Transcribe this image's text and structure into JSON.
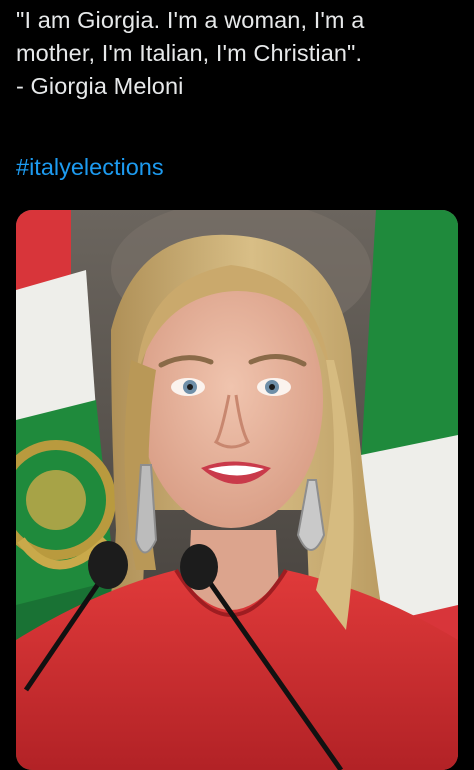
{
  "tweet": {
    "text_lines": [
      "\"I am Giorgia. I'm a woman, I'm a",
      "mother, I'm Italian, I'm Christian\".",
      "- Giorgia Meloni"
    ],
    "hashtag": "#italyelections"
  },
  "media": {
    "alt": "Photo of a smiling blonde woman in a red top speaking at two microphones in front of Italian flags",
    "colors": {
      "flag_green": "#1f8a3c",
      "flag_white": "#eeeeea",
      "flag_red": "#d8353a",
      "top_red": "#d62e30",
      "hair": "#c8a86e",
      "skin": "#e8b49e",
      "background_wall": "#5a5550"
    }
  },
  "colors": {
    "background": "#000000",
    "text": "#e7e9ea",
    "link": "#1d9bf0"
  }
}
